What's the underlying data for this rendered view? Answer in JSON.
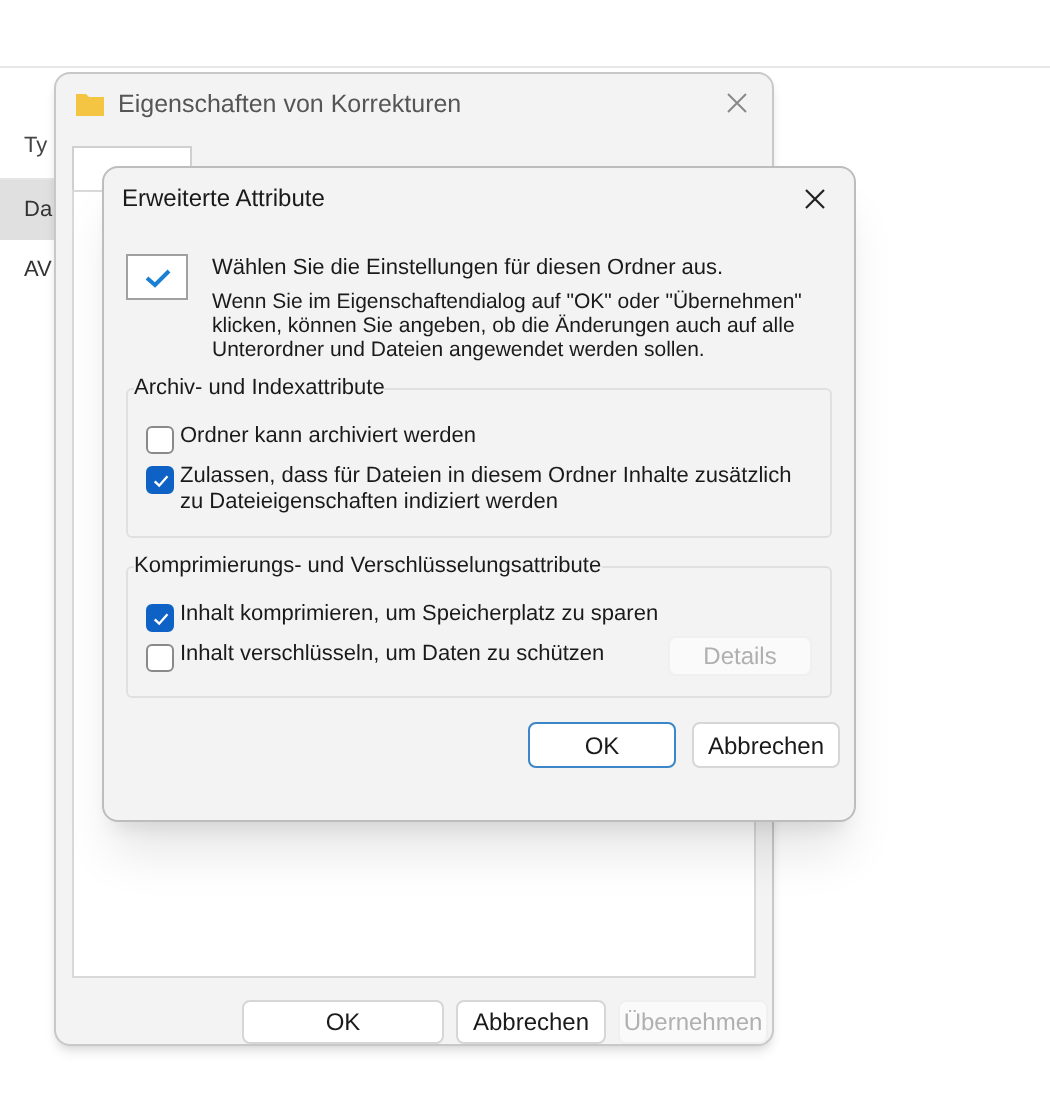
{
  "explorer": {
    "column_header": "Ty",
    "rows": [
      {
        "label": "Da",
        "selected": true
      },
      {
        "label": "AV",
        "selected": false
      }
    ]
  },
  "properties_window": {
    "title": "Eigenschaften von Korrekturen",
    "buttons": [
      {
        "label": "OK",
        "disabled": false
      },
      {
        "label": "Abbrechen",
        "disabled": false
      },
      {
        "label": "Übernehmen",
        "disabled": true
      }
    ]
  },
  "dialog": {
    "title": "Erweiterte Attribute",
    "heading": "Wählen Sie die Einstellungen für diesen Ordner aus.",
    "description": "Wenn Sie im Eigenschaftendialog auf \"OK\" oder \"Übernehmen\" klicken, können Sie angeben, ob die Änderungen auch auf alle Unterordner und Dateien angewendet werden sollen.",
    "groups": [
      {
        "title": "Archiv- und Indexattribute",
        "options": [
          {
            "label": "Ordner kann archiviert werden",
            "checked": false
          },
          {
            "label": "Zulassen, dass für Dateien in diesem Ordner Inhalte zusätzlich zu Dateieigenschaften indiziert werden",
            "checked": true
          }
        ]
      },
      {
        "title": "Komprimierungs- und Verschlüsselungsattribute",
        "options": [
          {
            "label": "Inhalt komprimieren, um Speicherplatz zu sparen",
            "checked": true
          },
          {
            "label": "Inhalt verschlüsseln, um Daten zu schützen",
            "checked": false
          }
        ],
        "button": {
          "label": "Details",
          "disabled": true
        }
      }
    ],
    "buttons": [
      {
        "label": "OK",
        "default": true
      },
      {
        "label": "Abbrechen",
        "default": false
      }
    ]
  }
}
